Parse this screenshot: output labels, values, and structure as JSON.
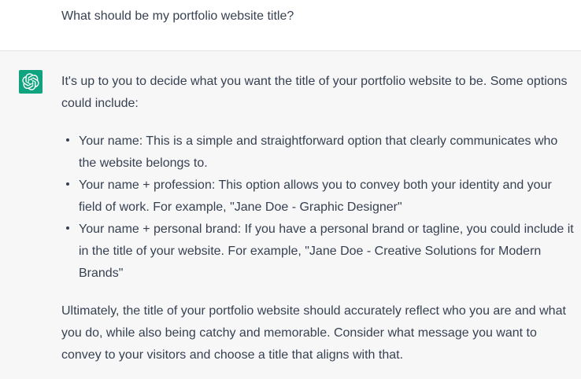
{
  "user_message": {
    "text": "What should be my portfolio website title?"
  },
  "assistant_message": {
    "avatar_icon": "openai-logo-icon",
    "avatar_color": "#10a37f",
    "intro": "It's up to you to decide what you want the title of your portfolio website to be. Some options could include:",
    "options": [
      {
        "text": "Your name: This is a simple and straightforward option that clearly communicates who the website belongs to."
      },
      {
        "text": "Your name + profession: This option allows you to convey both your identity and your field of work. For example, \"Jane Doe - Graphic Designer\""
      },
      {
        "text": "Your name + personal brand: If you have a personal brand or tagline, you could include it in the title of your website. For example, \"Jane Doe - Creative Solutions for Modern Brands\""
      }
    ],
    "conclusion": "Ultimately, the title of your portfolio website should accurately reflect who you are and what you do, while also being catchy and memorable. Consider what message you want to convey to your visitors and choose a title that aligns with that."
  }
}
